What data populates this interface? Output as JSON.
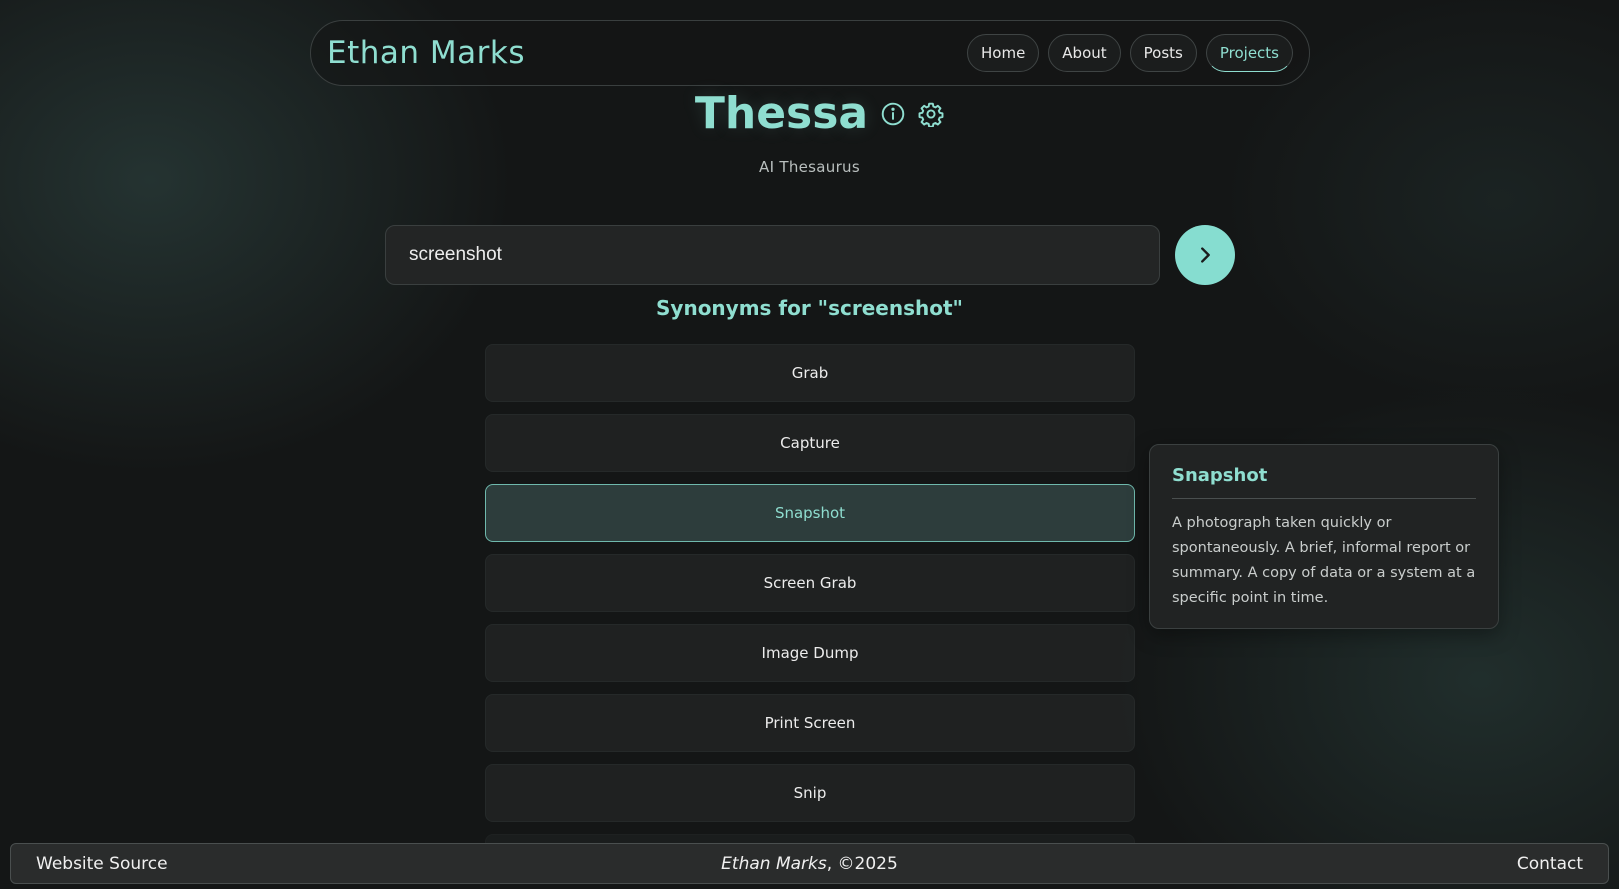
{
  "header": {
    "brand": "Ethan Marks",
    "nav": [
      "Home",
      "About",
      "Posts",
      "Projects"
    ],
    "active_nav": "Projects"
  },
  "app": {
    "title": "Thessa",
    "subtitle": "AI Thesaurus",
    "info_icon": "info-icon",
    "settings_icon": "gear-icon"
  },
  "search": {
    "value": "screenshot",
    "submit_icon": "chevron-right-icon"
  },
  "results": {
    "heading": "Synonyms for \"screenshot\"",
    "items": [
      "Grab",
      "Capture",
      "Snapshot",
      "Screen Grab",
      "Image Dump",
      "Print Screen",
      "Snip"
    ],
    "selected": "Snapshot"
  },
  "definition": {
    "word": "Snapshot",
    "text": "A photograph taken quickly or spontaneously. A brief, informal report or summary. A copy of data or a system at a specific point in time."
  },
  "footer": {
    "source_link": "Website Source",
    "author": "Ethan Marks",
    "copyright": ", ©2025",
    "contact_link": "Contact"
  },
  "colors": {
    "accent": "#8fded0",
    "button": "#86ddd0",
    "background": "#141616"
  }
}
